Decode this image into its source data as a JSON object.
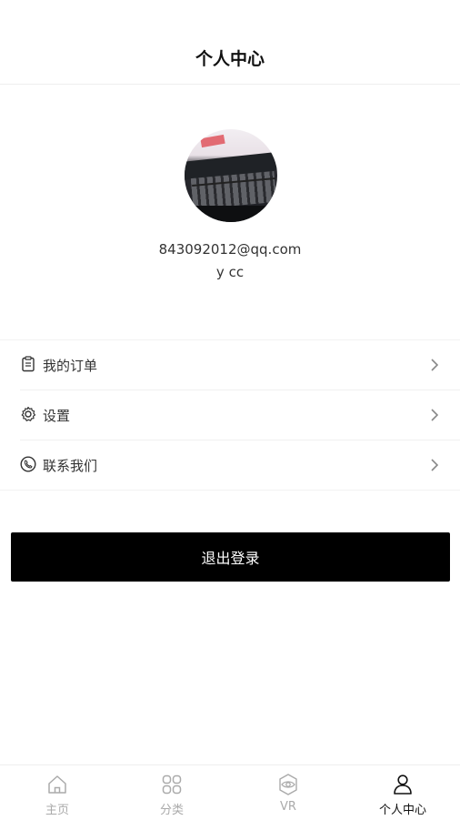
{
  "header": {
    "title": "个人中心"
  },
  "profile": {
    "email": "843092012@qq.com",
    "nickname": "y cc"
  },
  "menu": {
    "items": [
      {
        "label": "我的订单",
        "icon": "clipboard-icon"
      },
      {
        "label": "设置",
        "icon": "gear-icon"
      },
      {
        "label": "联系我们",
        "icon": "phone-icon"
      }
    ]
  },
  "logout": {
    "label": "退出登录"
  },
  "tabbar": {
    "items": [
      {
        "label": "主页",
        "icon": "home-icon",
        "active": false
      },
      {
        "label": "分类",
        "icon": "grid-icon",
        "active": false
      },
      {
        "label": "VR",
        "icon": "eye-icon",
        "active": false
      },
      {
        "label": "个人中心",
        "icon": "user-icon",
        "active": true
      }
    ]
  },
  "colors": {
    "active_tab": "#111111",
    "inactive_tab": "#aaaaaa",
    "logout_bg": "#000000"
  }
}
